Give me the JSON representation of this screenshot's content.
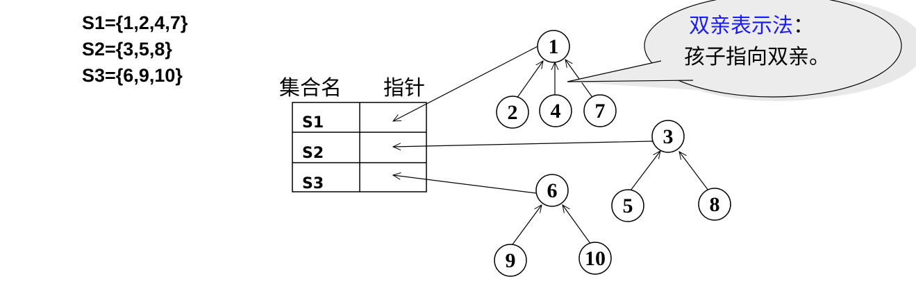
{
  "sets": [
    "S1={1,2,4,7}",
    "S2={3,5,8}",
    "S3={6,9,10}"
  ],
  "table": {
    "header_name": "集合名",
    "header_pointer": "指针",
    "rows": [
      "S1",
      "S2",
      "S3"
    ]
  },
  "nodes": {
    "n1": "1",
    "n2": "2",
    "n4": "4",
    "n7": "7",
    "n3": "3",
    "n5": "5",
    "n8": "8",
    "n6": "6",
    "n9": "9",
    "n10": "10"
  },
  "callout": {
    "title": "双亲表示法",
    "title_suffix": "：",
    "body": "孩子指向双亲。",
    "title_color": "#1a1aff"
  }
}
